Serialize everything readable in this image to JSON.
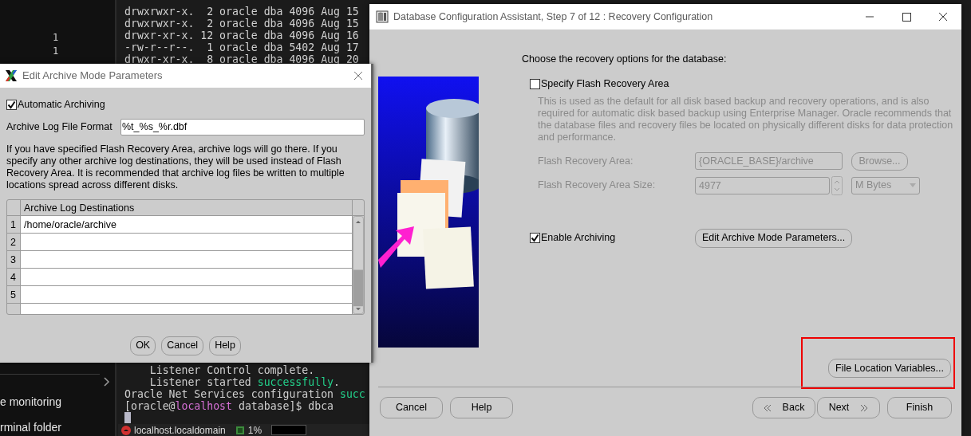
{
  "sidebar": {
    "numbers": [
      "1",
      "1"
    ],
    "items": [
      "e monitoring",
      "rminal folder"
    ]
  },
  "terminal": {
    "top_lines": [
      [
        {
          "text": "drwxrwxr-x.  2 oracle dba 4096 Aug 15",
          "kind": "plain"
        }
      ],
      [
        {
          "text": "drwxrwxr-x.  2 oracle dba 4096 Aug 15",
          "kind": "plain"
        }
      ],
      [
        {
          "text": "drwxr-xr-x. 12 oracle dba 4096 Aug 16",
          "kind": "plain"
        }
      ],
      [
        {
          "text": "-rw-r--r--.  1 oracle dba 5402 Aug 17",
          "kind": "plain"
        }
      ],
      [
        {
          "text": "drwxr-xr-x.  8 oracle dba 4096 Aug 20",
          "kind": "plain"
        }
      ]
    ],
    "bottom_lines": [
      [
        {
          "text": "    Listener Control complete.",
          "kind": "plain"
        }
      ],
      [
        {
          "text": "    Listener started ",
          "kind": "plain"
        },
        {
          "text": "successfully",
          "kind": "ok"
        },
        {
          "text": ".",
          "kind": "plain"
        }
      ],
      [
        {
          "text": "Oracle Net Services configuration ",
          "kind": "plain"
        },
        {
          "text": "succ",
          "kind": "ok"
        }
      ],
      [
        {
          "text": "[oracle@",
          "kind": "plain"
        },
        {
          "text": "localhost",
          "kind": "host"
        },
        {
          "text": " database]$ dbca",
          "kind": "plain"
        }
      ]
    ]
  },
  "taskbar": {
    "items": [
      {
        "kind": "host",
        "label": "localhost.localdomain"
      },
      {
        "kind": "cpu",
        "label": "1%"
      }
    ]
  },
  "archive_dialog": {
    "title": "Edit Archive Mode Parameters",
    "automatic_archiving": {
      "label": "Automatic Archiving",
      "checked": true
    },
    "format_field": {
      "label": "Archive Log File Format",
      "value": "%t_%s_%r.dbf"
    },
    "note": "If you have specified Flash Recovery Area, archive logs will go there. If you specify any other archive log destinations, they will be used instead of Flash Recovery Area. It is recommended that archive log files be written to multiple locations spread across different disks.",
    "table": {
      "column": "Archive Log Destinations",
      "rows": [
        {
          "number": "1",
          "value": "/home/oracle/archive"
        },
        {
          "number": "2"
        },
        {
          "number": "3"
        },
        {
          "number": "4"
        },
        {
          "number": "5"
        }
      ]
    },
    "buttons": [
      "OK",
      "Cancel",
      "Help"
    ]
  },
  "dbca_window": {
    "title": "Database Configuration Assistant, Step 7 of 12 : Recovery Configuration",
    "heading": "Choose the recovery options for the database:",
    "flash_recovery": {
      "label": "Specify Flash Recovery Area",
      "checked": false
    },
    "description": "This is used as the default for all disk based backup and recovery operations, and is also required for automatic disk based backup using Enterprise Manager. Oracle recommends that the database files and recovery files be located on physically different disks for data protection and performance.",
    "area_field": {
      "label": "Flash Recovery Area:",
      "value": "{ORACLE_BASE}/archive",
      "disabled": true
    },
    "browse_button": {
      "label": "Browse...",
      "disabled": true
    },
    "size_field": {
      "label": "Flash Recovery Area Size:",
      "value": "4977",
      "disabled": true
    },
    "unit_dropdown": {
      "value": "M Bytes",
      "disabled": true
    },
    "enable_archiving": {
      "label": "Enable Archiving",
      "checked": true
    },
    "edit_button": "Edit Archive Mode Parameters...",
    "file_location_button": "File Location Variables...",
    "left_buttons": [
      "Cancel",
      "Help"
    ],
    "right_buttons": [
      {
        "kind": "back",
        "label": "Back"
      },
      {
        "kind": "next",
        "label": "Next"
      },
      {
        "kind": "plain",
        "label": "Finish"
      }
    ]
  }
}
